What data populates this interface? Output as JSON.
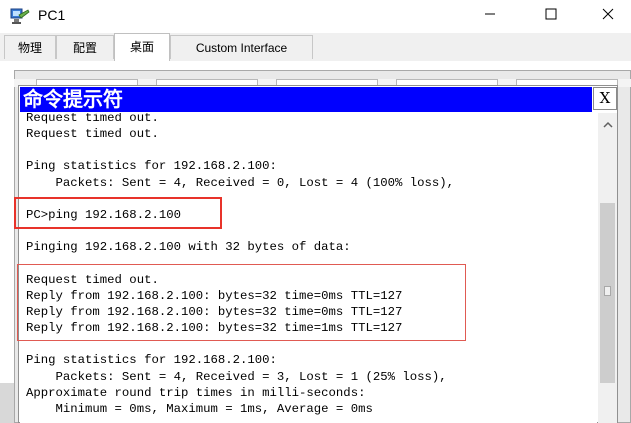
{
  "window": {
    "title": "PC1",
    "icons": {
      "app": "pc-terminal-icon",
      "minimize": "minimize-icon",
      "maximize": "maximize-icon",
      "close": "close-icon"
    }
  },
  "tabs": [
    {
      "label": "物理",
      "active": false
    },
    {
      "label": "配置",
      "active": false
    },
    {
      "label": "桌面",
      "active": true
    },
    {
      "label": "Custom Interface",
      "active": false
    }
  ],
  "command_prompt": {
    "title": "命令提示符",
    "close_label": "X",
    "title_bar_color": "#0000ff",
    "lines": [
      "Request timed out.",
      "Request timed out.",
      "",
      "Ping statistics for 192.168.2.100:",
      "    Packets: Sent = 4, Received = 0, Lost = 4 (100% loss),",
      "",
      "PC>ping 192.168.2.100",
      "",
      "Pinging 192.168.2.100 with 32 bytes of data:",
      "",
      "Request timed out.",
      "Reply from 192.168.2.100: bytes=32 time=0ms TTL=127",
      "Reply from 192.168.2.100: bytes=32 time=0ms TTL=127",
      "Reply from 192.168.2.100: bytes=32 time=1ms TTL=127",
      "",
      "Ping statistics for 192.168.2.100:",
      "    Packets: Sent = 4, Received = 3, Lost = 1 (25% loss),",
      "Approximate round trip times in milli-seconds:",
      "    Minimum = 0ms, Maximum = 1ms, Average = 0ms"
    ],
    "scrollbar": {
      "up_icon": "scroll-up-arrow-icon"
    }
  },
  "annotations": {
    "highlight_color": "#e8332a"
  }
}
